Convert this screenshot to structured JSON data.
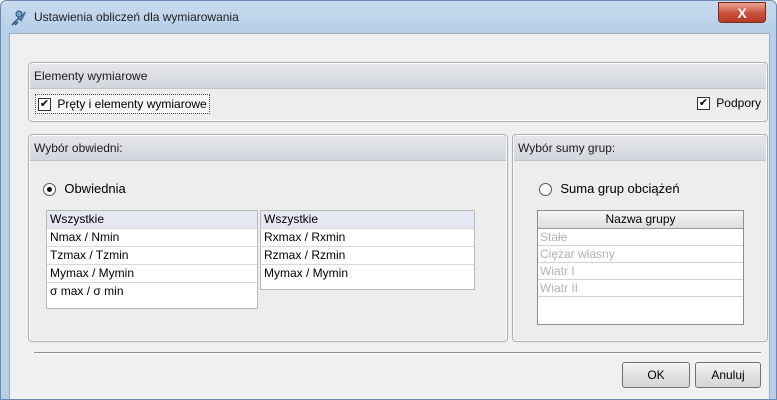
{
  "window": {
    "title": "Ustawienia obliczeń dla wymiarowania",
    "close_symbol": "X"
  },
  "elements_panel": {
    "header": "Elementy wymiarowe",
    "bars_checkbox": {
      "label": "Pręty i elementy wymiarowe",
      "checked": true,
      "mark": "✔"
    },
    "supports_checkbox": {
      "label": "Podpory",
      "checked": true,
      "mark": "✔"
    }
  },
  "envelope_panel": {
    "header": "Wybór obwiedni:",
    "radio": {
      "label": "Obwiednia",
      "selected": true
    },
    "left_list": [
      "Wszystkie",
      "Nmax / Nmin",
      "Tzmax / Tzmin",
      "Mymax / Mymin",
      "σ max / σ min"
    ],
    "right_list": [
      "Wszystkie",
      "Rxmax / Rxmin",
      "Rzmax / Rzmin",
      "Mymax / Mymin"
    ]
  },
  "groups_panel": {
    "header": "Wybór sumy grup:",
    "radio": {
      "label": "Suma grup obciążeń",
      "selected": false
    },
    "table": {
      "column": "Nazwa grupy",
      "rows": [
        "Stałe",
        "Ciężar własny",
        "Wiatr I",
        "Wiatr II"
      ]
    }
  },
  "buttons": {
    "ok": "OK",
    "cancel": "Anuluj"
  }
}
